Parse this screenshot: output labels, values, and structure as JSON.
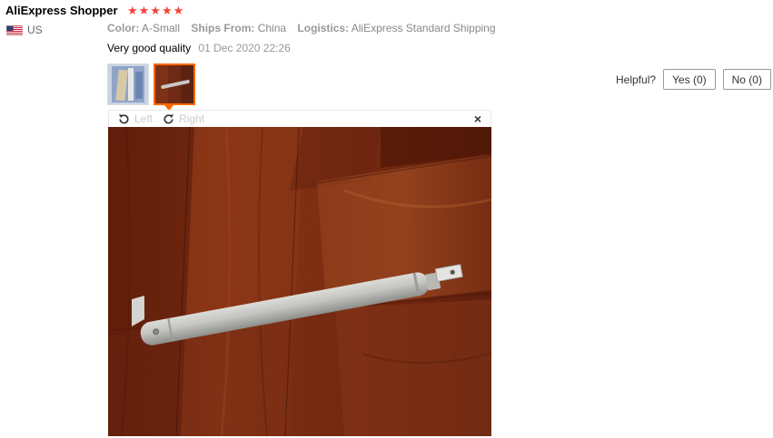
{
  "reviewer": {
    "name": "AliExpress Shopper",
    "stars": "★★★★★",
    "country": "US"
  },
  "attributes": {
    "color_label": "Color:",
    "color_value": "A-Small",
    "ships_label": "Ships From:",
    "ships_value": "China",
    "logistics_label": "Logistics:",
    "logistics_value": "AliExpress Standard Shipping"
  },
  "feedback": {
    "text": "Very good quality",
    "date": "01 Dec 2020 22:26"
  },
  "viewer": {
    "rotate_left": "Left",
    "rotate_right": "Right",
    "close": "×"
  },
  "helpful": {
    "label": "Helpful?",
    "yes": "Yes (0)",
    "no": "No (0)"
  },
  "colors": {
    "star": "#f44336",
    "active_thumb": "#ff6a00",
    "wood": "#7a2a10"
  }
}
